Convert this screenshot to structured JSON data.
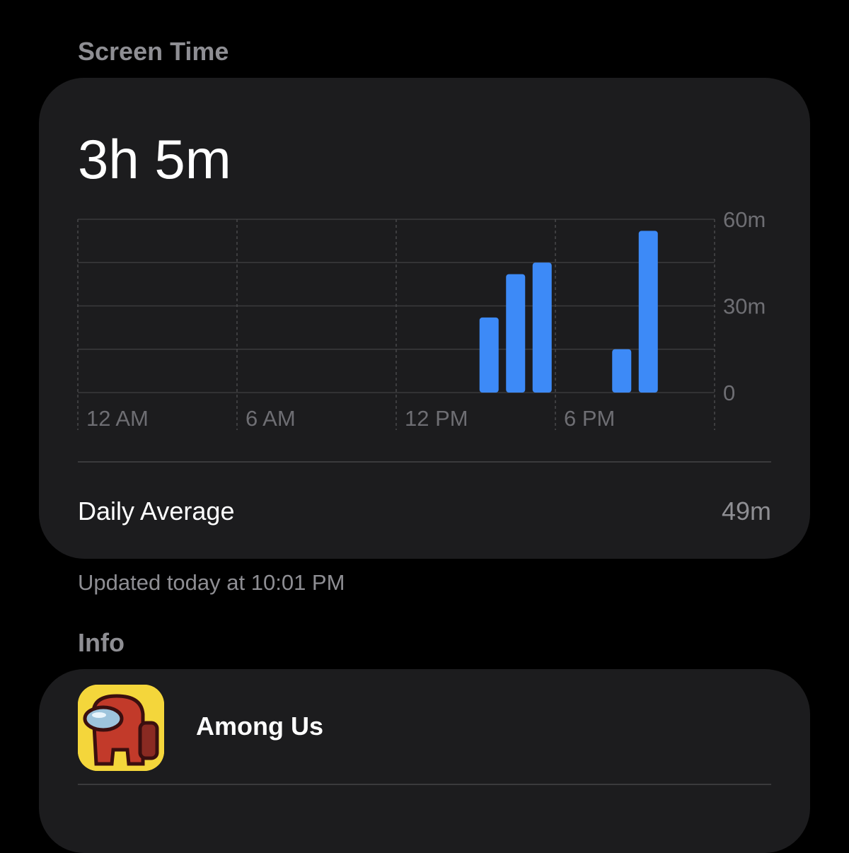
{
  "sections": {
    "screen_time_header": "Screen Time",
    "info_header": "Info"
  },
  "screen_time": {
    "total": "3h 5m",
    "daily_average_label": "Daily Average",
    "daily_average_value": "49m",
    "updated": "Updated today at 10:01 PM"
  },
  "chart_data": {
    "type": "bar",
    "x_tick_labels": [
      "12 AM",
      "6 AM",
      "12 PM",
      "6 PM"
    ],
    "y_tick_labels": [
      "60m",
      "30m",
      "0"
    ],
    "ylim": [
      0,
      60
    ],
    "bars": [
      {
        "hour": 15,
        "value": 26
      },
      {
        "hour": 16,
        "value": 41
      },
      {
        "hour": 17,
        "value": 45
      },
      {
        "hour": 20,
        "value": 15
      },
      {
        "hour": 21,
        "value": 56
      }
    ],
    "grid": true
  },
  "info": {
    "app_name": "Among Us",
    "app_icon": "among-us-crewmate-icon"
  },
  "colors": {
    "background": "#000000",
    "card": "#1c1c1e",
    "bar": "#3d8af7",
    "secondary_text": "#8e8e93",
    "icon_background": "#f2d33a"
  }
}
